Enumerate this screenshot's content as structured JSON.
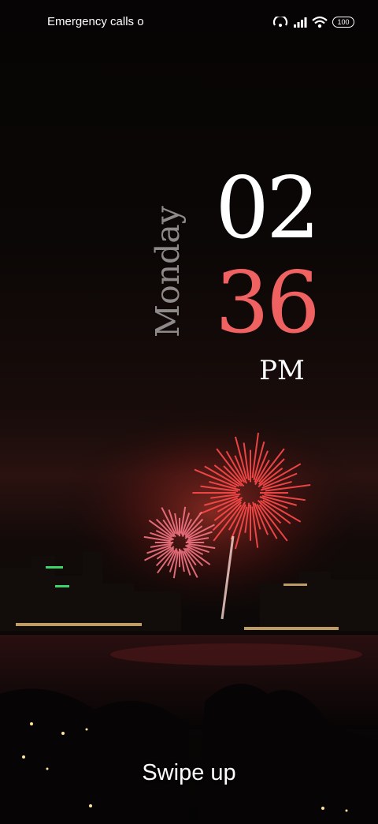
{
  "status_bar": {
    "carrier_text": "Emergency calls o",
    "battery_level": "100",
    "icons": [
      "hotspot-icon",
      "signal-icon",
      "wifi-icon",
      "battery-icon"
    ]
  },
  "lockscreen": {
    "weekday": "Monday",
    "hour": "02",
    "minute": "36",
    "ampm": "PM",
    "hint": "Swipe up"
  },
  "colors": {
    "hour": "#ffffff",
    "minute": "#f06262",
    "weekday": "#8e8a89"
  },
  "wallpaper": "fireworks-over-city-skyline"
}
